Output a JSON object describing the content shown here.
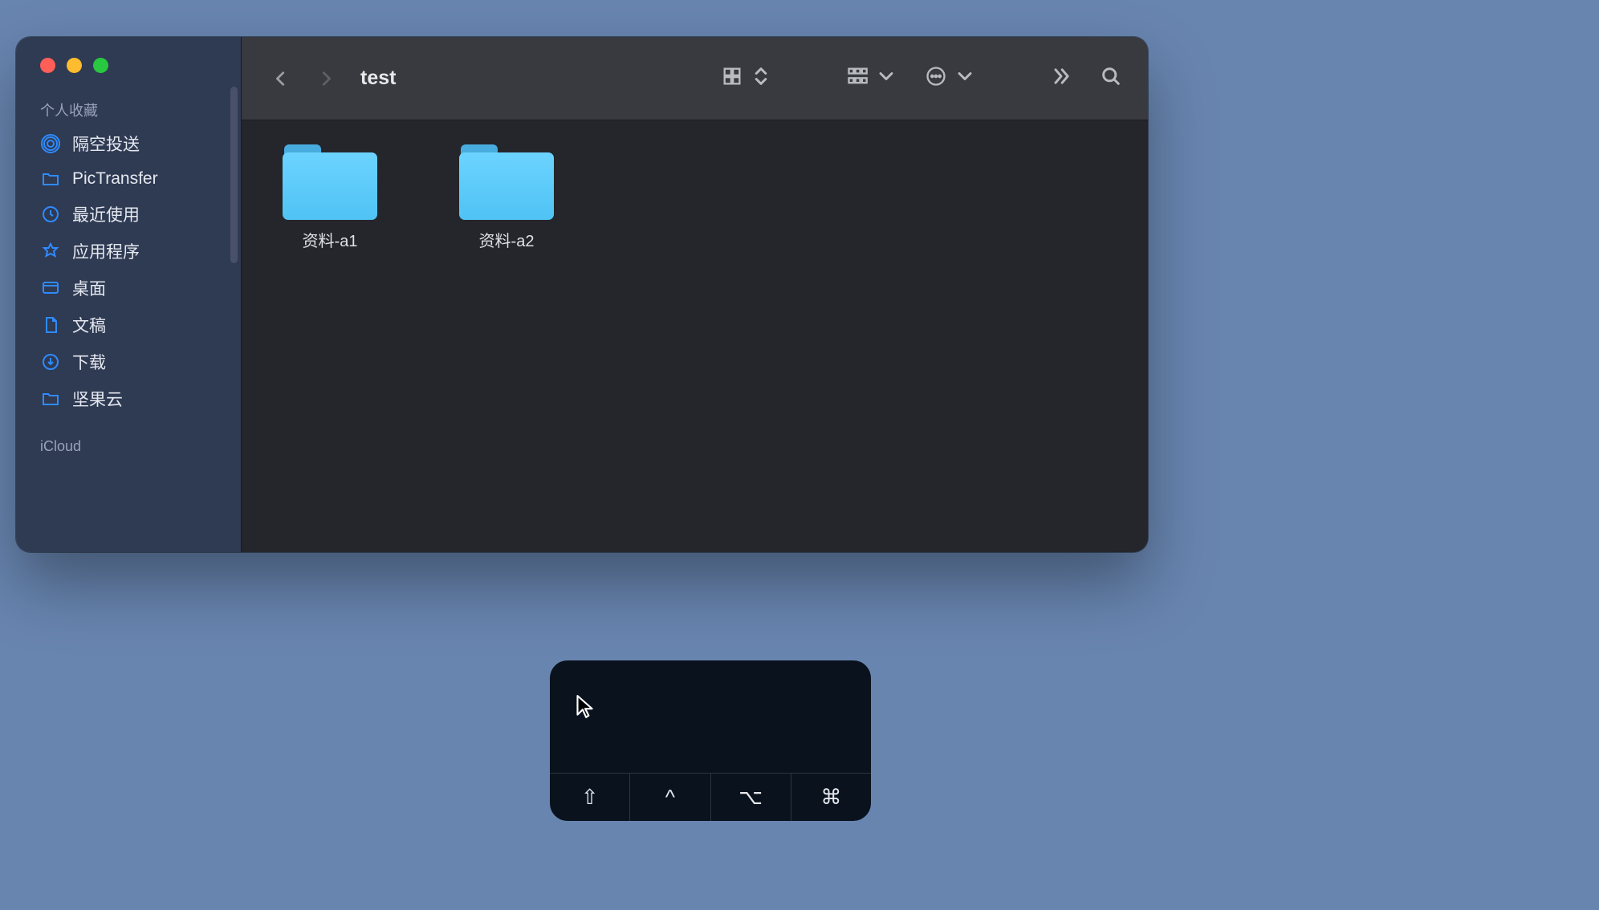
{
  "window": {
    "title": "test"
  },
  "sidebar": {
    "section1_title": "个人收藏",
    "items": [
      {
        "label": "隔空投送",
        "icon": "airdrop-icon"
      },
      {
        "label": "PicTransfer",
        "icon": "folder-icon"
      },
      {
        "label": "最近使用",
        "icon": "clock-icon"
      },
      {
        "label": "应用程序",
        "icon": "applications-icon"
      },
      {
        "label": "桌面",
        "icon": "desktop-icon"
      },
      {
        "label": "文稿",
        "icon": "document-icon"
      },
      {
        "label": "下载",
        "icon": "download-icon"
      },
      {
        "label": "坚果云",
        "icon": "folder-icon"
      }
    ],
    "section2_title": "iCloud"
  },
  "folders": [
    {
      "name": "资料-a1"
    },
    {
      "name": "资料-a2"
    }
  ],
  "hud": {
    "keys": [
      "⇧",
      "^",
      "⌥",
      "⌘"
    ]
  }
}
